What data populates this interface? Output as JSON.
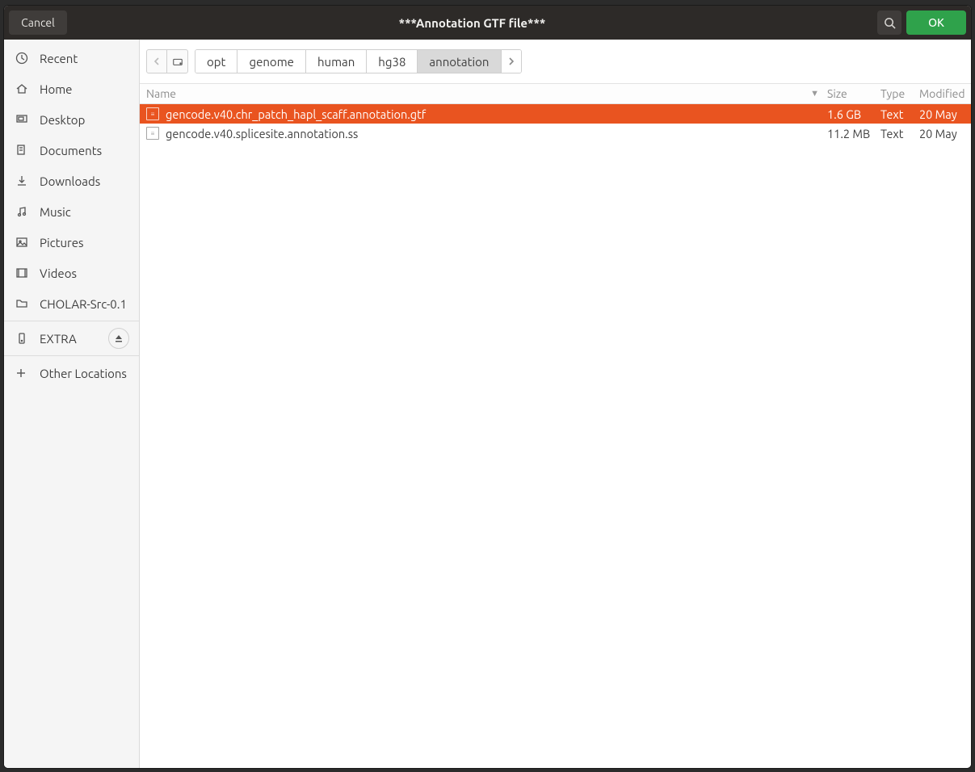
{
  "header": {
    "cancel": "Cancel",
    "title": "***Annotation GTF file***",
    "ok": "OK"
  },
  "sidebar": {
    "items": [
      {
        "label": "Recent"
      },
      {
        "label": "Home"
      },
      {
        "label": "Desktop"
      },
      {
        "label": "Documents"
      },
      {
        "label": "Downloads"
      },
      {
        "label": "Music"
      },
      {
        "label": "Pictures"
      },
      {
        "label": "Videos"
      },
      {
        "label": "CHOLAR-Src-0.1"
      }
    ],
    "extra": {
      "label": "EXTRA"
    },
    "other": {
      "label": "Other Locations"
    }
  },
  "path": {
    "segments": [
      "opt",
      "genome",
      "human",
      "hg38",
      "annotation"
    ],
    "active_index": 4
  },
  "columns": {
    "name": "Name",
    "size": "Size",
    "type": "Type",
    "modified": "Modified"
  },
  "files": [
    {
      "name": "gencode.v40.chr_patch_hapl_scaff.annotation.gtf",
      "size": "1.6 GB",
      "type": "Text",
      "modified": "20 May",
      "selected": true
    },
    {
      "name": "gencode.v40.splicesite.annotation.ss",
      "size": "11.2 MB",
      "type": "Text",
      "modified": "20 May",
      "selected": false
    }
  ]
}
